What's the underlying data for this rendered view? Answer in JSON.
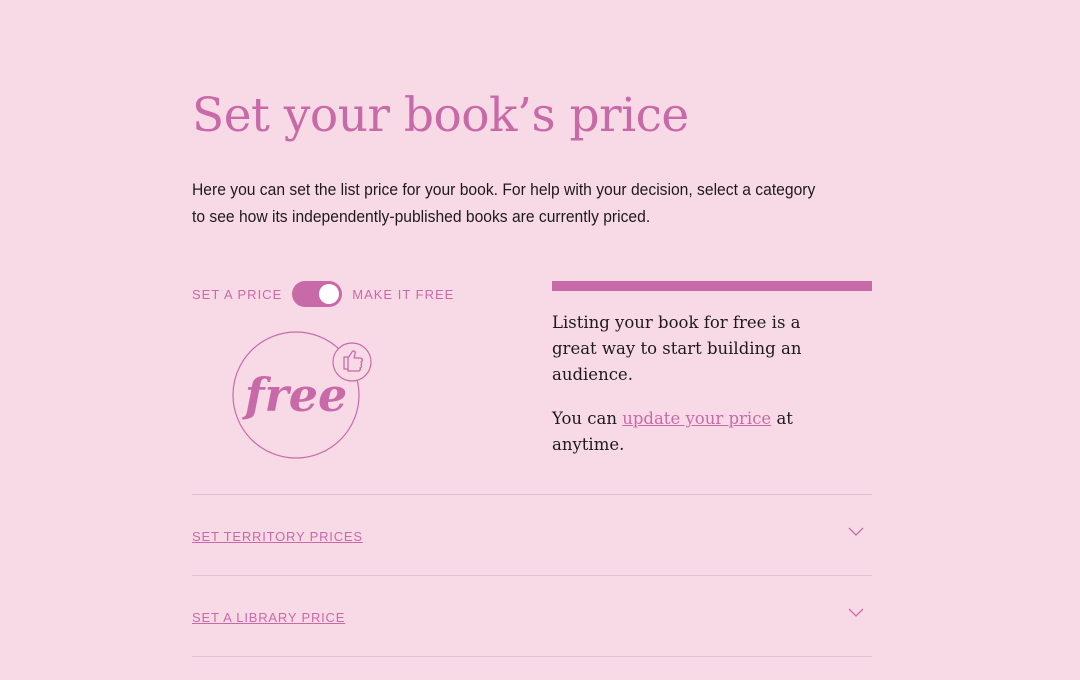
{
  "page": {
    "title": "Set your book’s price",
    "intro": "Here you can set the list price for your book. For help with your decision, select a category to see how its independently-published books are currently priced."
  },
  "pricing_toggle": {
    "left_label": "SET A PRICE",
    "right_label": "MAKE IT FREE",
    "state": "make-it-free"
  },
  "badge": {
    "text": "free",
    "icon": "thumbs-up-icon"
  },
  "info": {
    "paragraph1": "Listing your book for free is a great way to start building an audience.",
    "para2_prefix": "You can ",
    "para2_link": "update your price",
    "para2_suffix": " at anytime."
  },
  "accordions": [
    {
      "label": "SET TERRITORY PRICES",
      "icon": "chevron-down-icon"
    },
    {
      "label": "SET A LIBRARY PRICE",
      "icon": "chevron-down-icon"
    }
  ],
  "colors": {
    "background": "#f8dae7",
    "accent": "#c96aa8",
    "text": "#1e1a1c",
    "divider": "#e5bfd0"
  }
}
